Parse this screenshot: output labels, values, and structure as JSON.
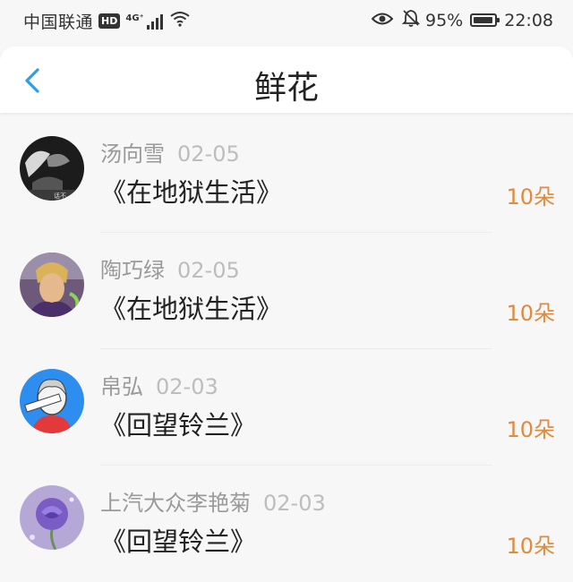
{
  "status_bar": {
    "carrier": "中国联通",
    "hd_badge": "HD",
    "network": "4G⁺",
    "battery_percent": "95%",
    "battery_level": 0.95,
    "time": "22:08"
  },
  "header": {
    "title": "鲜花"
  },
  "items": [
    {
      "name": "汤向雪",
      "date": "02-05",
      "title": "《在地狱生活》",
      "count": "10朵"
    },
    {
      "name": "陶巧绿",
      "date": "02-05",
      "title": "《在地狱生活》",
      "count": "10朵"
    },
    {
      "name": "帛弘",
      "date": "02-03",
      "title": "《回望铃兰》",
      "count": "10朵"
    },
    {
      "name": "上汽大众李艳菊",
      "date": "02-03",
      "title": "《回望铃兰》",
      "count": "10朵"
    }
  ],
  "colors": {
    "accent_blue": "#2f9ee6",
    "count_orange": "#e08a3c"
  }
}
